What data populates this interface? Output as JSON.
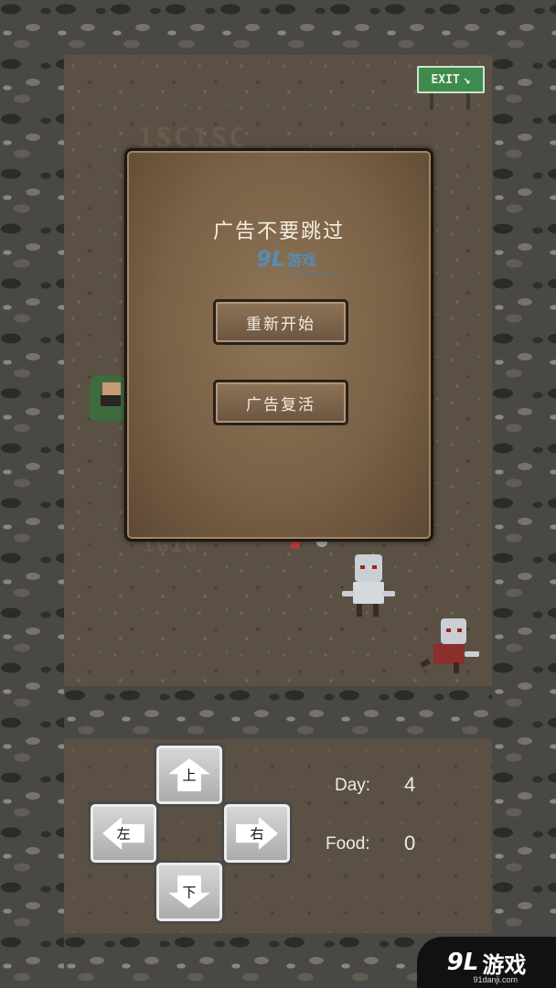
{
  "map": {
    "exit_sign": "EXIT",
    "floor_text_top": "1SC1SC",
    "floor_text_bottom": "IGIG"
  },
  "dialog": {
    "title": "广告不要跳过",
    "restart_label": "重新开始",
    "revive_label": "广告复活",
    "watermark_num": "9L",
    "watermark_text": "游戏",
    "watermark_url": "91danji.com"
  },
  "controls": {
    "up": "上",
    "down": "下",
    "left": "左",
    "right": "右"
  },
  "stats": {
    "day_label": "Day:",
    "day_value": "4",
    "food_label": "Food:",
    "food_value": "0"
  },
  "corner_logo": {
    "num": "9L",
    "text": "游戏",
    "url": "91danji.com"
  },
  "colors": {
    "dialog_bg": "#7a6147",
    "exit_green": "#3f8a4d",
    "watermark_blue": "#4f92c6"
  }
}
